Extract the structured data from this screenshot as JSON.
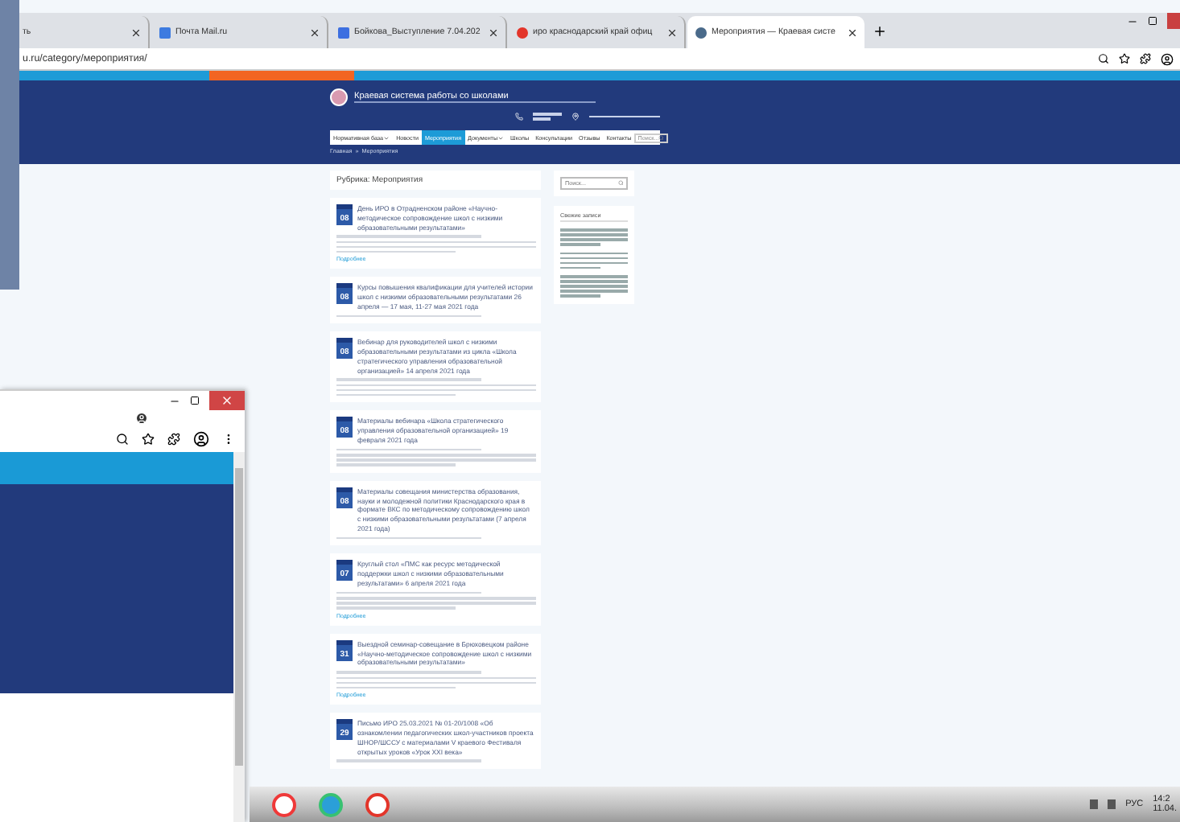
{
  "browser": {
    "tabs": [
      {
        "title": "ть",
        "kind": "plain",
        "selected": false
      },
      {
        "title": "Почта Mail.ru",
        "kind": "mail",
        "selected": false
      },
      {
        "title": "Бойкова_Выступление 7.04.202",
        "kind": "doc",
        "selected": false
      },
      {
        "title": "иро краснодарский край офиц",
        "kind": "yandex",
        "selected": false
      },
      {
        "title": "Мероприятия — Краевая систе",
        "kind": "wordpress",
        "selected": true
      }
    ],
    "address": "u.ru/category/мероприятия/"
  },
  "site": {
    "title": "Краевая система работы со школами",
    "nav": [
      {
        "label": "Нормативная база",
        "dropdown": true,
        "selected": false
      },
      {
        "label": "Новости",
        "dropdown": false,
        "selected": false
      },
      {
        "label": "Мероприятия",
        "dropdown": false,
        "selected": true
      },
      {
        "label": "Документы",
        "dropdown": true,
        "selected": false
      },
      {
        "label": "Школы",
        "dropdown": false,
        "selected": false
      },
      {
        "label": "Консультации",
        "dropdown": false,
        "selected": false
      },
      {
        "label": "Отзывы",
        "dropdown": false,
        "selected": false
      },
      {
        "label": "Контакты",
        "dropdown": false,
        "selected": false
      }
    ],
    "nav_search_placeholder": "Поиск...",
    "breadcrumb": {
      "items": [
        "Главная",
        "Мероприятия"
      ],
      "separator": "»"
    },
    "heading": "Рубрика: Мероприятия",
    "posts": [
      {
        "day": "08",
        "title": "День ИРО в Отрадненском районе «Научно-методическое сопровождение школ с низкими образовательными результатами»",
        "excerpt": true,
        "more": "Подробнее"
      },
      {
        "day": "08",
        "title": "Курсы повышения квалификации для учителей истории школ с низкими образовательными результатами 26 апреля — 17 мая, 11-27 мая 2021 года",
        "excerpt": false
      },
      {
        "day": "08",
        "title": "Вебинар для руководителей школ с низкими образовательными результатами из цикла «Школа стратегического управления образовательной организацией» 14 апреля 2021 года",
        "excerpt": true
      },
      {
        "day": "08",
        "title": "Материалы вебинара «Школа стратегического управления образовательной организацией» 19 февраля 2021 года",
        "excerpt": true
      },
      {
        "day": "08",
        "title": "Материалы совещания министерства образования, науки и молодежной политики Краснодарского края в формате ВКС по методическому сопровождению школ с низкими образовательными результатами (7 апреля 2021 года)",
        "excerpt": false
      },
      {
        "day": "07",
        "title": "Круглый стол «ПМС как ресурс методической поддержки школ с низкими образовательными результатами» 6 апреля 2021 года",
        "excerpt": true,
        "more": "Подробнее"
      },
      {
        "day": "31",
        "title": "Выездной семинар-совещание в Брюховецком районе «Научно-методическое сопровождение школ с низкими образовательными результатами»",
        "excerpt": true,
        "more": "Подробнее"
      },
      {
        "day": "29",
        "title": "Письмо ИРО 25.03.2021 № 01-20/1008 «Об ознакомлении педагогических школ-участников проекта ШНОР/ШССУ с материалами V краевого Фестиваля открытых уроков «Урок XXI века»",
        "excerpt": false
      }
    ],
    "sidebar": {
      "search_placeholder": "Поиск...",
      "recent_title": "Свежие записи"
    }
  },
  "taskbar": {
    "apps": [
      {
        "kind": "vivaldi"
      },
      {
        "kind": "edge"
      },
      {
        "kind": "yandex"
      }
    ],
    "language": "РУС",
    "time": "14:2",
    "date": "11.04."
  }
}
